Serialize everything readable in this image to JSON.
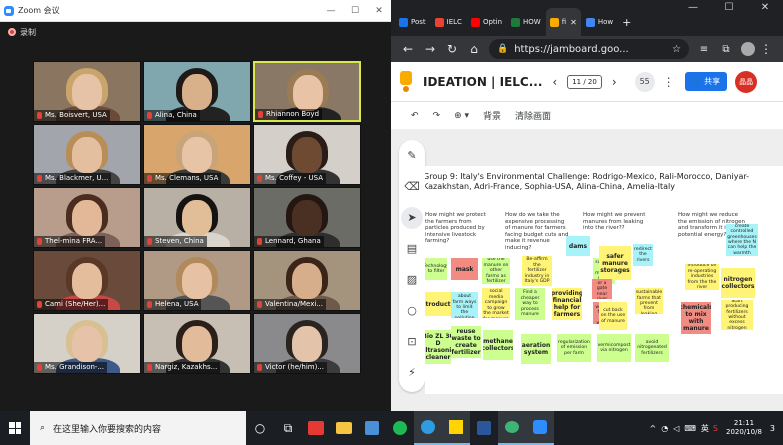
{
  "zoom": {
    "title": "Zoom 会议",
    "recording": "录制",
    "participants": [
      {
        "name": "Ms. Boisvert, USA",
        "bg": "#8a7560",
        "skin": "#e6c2a6",
        "hair": "#c9a56c",
        "shirt": "#6b4a3a"
      },
      {
        "name": "Alina, China",
        "bg": "#7fa7ad",
        "skin": "#d8b08a",
        "hair": "#1e1a18",
        "shirt": "#222"
      },
      {
        "name": "Rhiannon Boyd",
        "bg": "#8a7866",
        "skin": "#e8c3a5",
        "hair": "#9b7b55",
        "shirt": "#222"
      },
      {
        "name": "Ms. Blackmer, U...",
        "bg": "#a3a5ad",
        "skin": "#e3bfa0",
        "hair": "#b88d57",
        "shirt": "#444"
      },
      {
        "name": "Ms. Clemans, USA",
        "bg": "#d8a56c",
        "skin": "#e8c4a6",
        "hair": "#c8a47a",
        "shirt": "#3a3a3a"
      },
      {
        "name": "Ms. Coffey - USA",
        "bg": "#d4cfc8",
        "skin": "#6f4a33",
        "hair": "#2a1d17",
        "shirt": "#333"
      },
      {
        "name": "Thel-mina FRA...",
        "bg": "#b89d8c",
        "skin": "#e2b898",
        "hair": "#4a2d1e",
        "shirt": "#7c6158"
      },
      {
        "name": "Steven, China",
        "bg": "#b8b0a5",
        "skin": "#e1bd98",
        "hair": "#141212",
        "shirt": "#d9d4cc"
      },
      {
        "name": "Lennard, Ghana",
        "bg": "#6c6c67",
        "skin": "#4a3023",
        "hair": "#241712",
        "shirt": "#2e2e2e"
      },
      {
        "name": "Cami (She/Her)...",
        "bg": "#6a4a3a",
        "skin": "#e4bd9c",
        "hair": "#5a3828",
        "shirt": "#c84848"
      },
      {
        "name": "Helena, USA",
        "bg": "#b09a86",
        "skin": "#e6c1a3",
        "hair": "#b08a5a",
        "shirt": "#555"
      },
      {
        "name": "Valentina/Mexi...",
        "bg": "#a4947e",
        "skin": "#d7ae8c",
        "hair": "#3b2519",
        "shirt": "#6d5a4a"
      },
      {
        "name": "Ms. Grandison-...",
        "bg": "#d5d0c8",
        "skin": "#e6c3a8",
        "hair": "#d8c092",
        "shirt": "#3d5a8a"
      },
      {
        "name": "Nargiz, Kazakhs...",
        "bg": "#c7bfb4",
        "skin": "#e2bb9a",
        "hair": "#2a2019",
        "shirt": "#333"
      },
      {
        "name": "Victor (he/him)...",
        "bg": "#8a8a8c",
        "skin": "#e3c3aa",
        "hair": "#2a2420",
        "shirt": "#3c3c3c"
      }
    ]
  },
  "chrome": {
    "tabs": [
      {
        "label": "Post",
        "color": "#1a73e8"
      },
      {
        "label": "IELC",
        "color": "#ea4335"
      },
      {
        "label": "Optin",
        "color": "#ff0000"
      },
      {
        "label": "HOW",
        "color": "#1f7a3a"
      },
      {
        "label": "fi",
        "color": "#f9ab00"
      },
      {
        "label": "How",
        "color": "#4285f4"
      }
    ],
    "url": "https://jamboard.goo..."
  },
  "jam": {
    "title": "IDEATION | IELC...",
    "page": "11 / 20",
    "viewers": "55",
    "share": "共享",
    "user_initials": "晶晶",
    "toolbar": {
      "background": "背景",
      "clear": "清除画面"
    },
    "board_title": "Group 9: Italy's Environmental Challenge: Rodrigo-Mexico, Rali-Morocco, Daniyar-Kazakhstan, Adri-France, Sophia-USA, Alina-China, Amelia-Italy",
    "questions": [
      "How might we protect the farmers from particles produced by intensive livestock farming?",
      "How do we take the expensive processing of manure for farmers facing budget cuts and make it revenue inducing?",
      "How might we prevent manures from leaking into the river??",
      "How might we reduce the emission of nitrogen and transform it into potential energy?"
    ],
    "notes": [
      "Technology to filter",
      "mask",
      "use the manure on other farms as fertilizer",
      "Be-affirm the fertilizer industry in Italy's GDP",
      "dams",
      "subsidy the manure stock",
      "safer manure storages",
      "redirect the rivers",
      "create controlled greenhouses where the N can help the warmth",
      "Introduction",
      "Make rules about farm ways to limit the pollution",
      "Create a social media campaign to grow the market for manure",
      "Find a cheaper way to process manure",
      "providing financial help for farmers",
      "a dam or a gate near river",
      "find a way to filter the water",
      "introduce on re-operating industries from the the river",
      "nitrogen collectors",
      "cut back on the use of manure",
      "Make sustainable farms that prevent from leaking",
      "chemicals to mix with manure",
      "Start producing fertilizers without excess nitrogen",
      "Bio ZL 30 D ultrasonic cleaner",
      "reuse waste to create fertilizer",
      "methane collectors",
      "aeration system",
      "regularization of emission per farm",
      "vermicompost via nitrogen",
      "avoid nitrogenated fertilizers"
    ]
  },
  "taskbar": {
    "search": "在这里输入你要搜索的内容",
    "time": "21:11",
    "date": "2020/10/8",
    "lang": "英",
    "notify": "3"
  }
}
